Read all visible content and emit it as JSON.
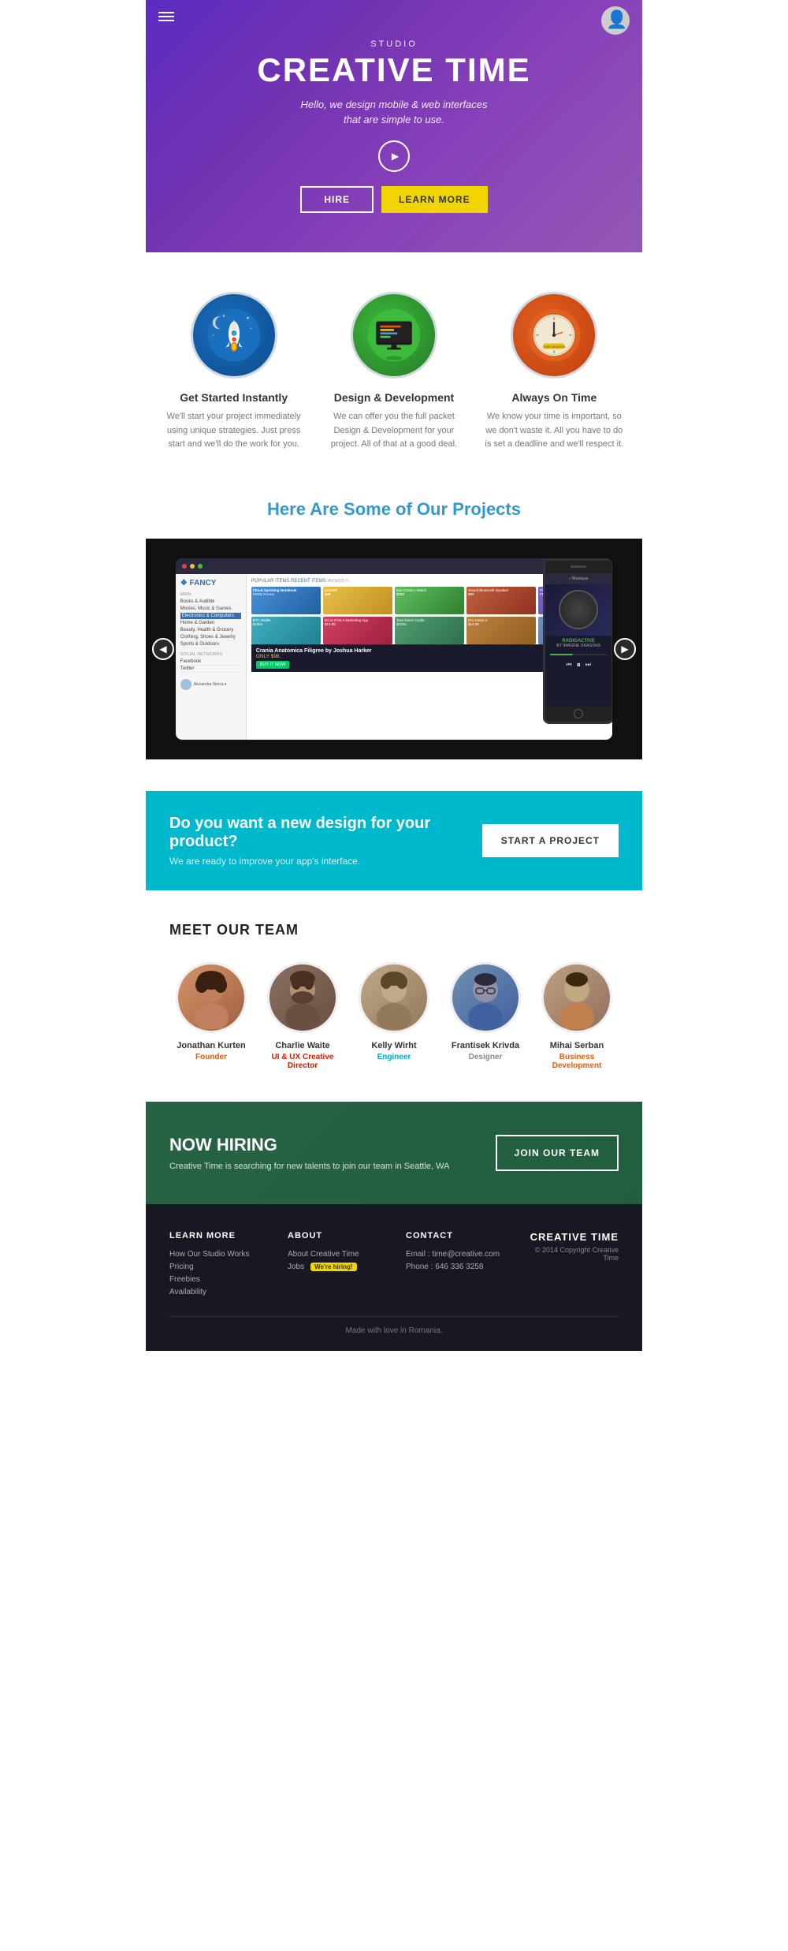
{
  "hero": {
    "studio_label": "STUDIO",
    "title": "CREATIVE TIME",
    "subtitle_line1": "Hello, we design mobile & web interfaces",
    "subtitle_line2": "that are simple to use.",
    "btn_hire": "HIRE",
    "btn_learn": "LEARN MORE"
  },
  "features": [
    {
      "id": "rocket",
      "title": "Get Started Instantly",
      "desc": "We'll start your project immediately using unique strategies. Just press start and we'll do the work for you."
    },
    {
      "id": "design",
      "title": "Design & Development",
      "desc": "We can offer you the full packet Design & Development for your project. All of that at a good deal."
    },
    {
      "id": "time",
      "title": "Always On Time",
      "desc": "We know your time is important, so we don't waste it. All you have to do is set a deadline and we'll respect it."
    }
  ],
  "projects": {
    "section_title": "Here Are Some of Our Projects",
    "arrow_left": "◀",
    "arrow_right": "▶",
    "product_name": "Crania Anatomica Filigree by Joshua Harker",
    "product_price": "ONLY $98.",
    "buy_label": "BUY IT NOW"
  },
  "cta": {
    "heading": "Do you want a new design for your product?",
    "subtext": "We are ready to improve your app's interface.",
    "button_label": "START A PROJECT"
  },
  "team": {
    "section_title": "MEET OUR TEAM",
    "members": [
      {
        "name": "Jonathan Kurten",
        "role": "Founder",
        "role_class": "role-orange"
      },
      {
        "name": "Charlie Waite",
        "role": "UI & UX Creative Director",
        "role_class": "role-red"
      },
      {
        "name": "Kelly Wirht",
        "role": "Engineer",
        "role_class": "role-cyan"
      },
      {
        "name": "Frantisek Krivda",
        "role": "Designer",
        "role_class": "role-gray"
      },
      {
        "name": "Mihai Serban",
        "role": "Business Development",
        "role_class": "role-orange2"
      }
    ]
  },
  "hiring": {
    "label": "NOW HIRING",
    "desc": "Creative Time is searching for new talents to join our team in Seattle, WA",
    "button_label": "JOIN OUR TEAM"
  },
  "footer": {
    "brand_name": "CREATIVE TIME",
    "copyright": "© 2014 Copyright Creative Time",
    "made_with": "Made with love in Romania.",
    "cols": [
      {
        "title": "LEARN MORE",
        "links": [
          "How Our Studio Works",
          "Pricing",
          "Freebies",
          "Availability"
        ]
      },
      {
        "title": "ABOUT",
        "links": [
          "About Creative Time",
          "Jobs"
        ]
      },
      {
        "title": "CONTACT",
        "links": [
          "Email : time@creative.com",
          "Phone : 646 336 3258"
        ]
      }
    ],
    "jobs_badge": "We're hiring!"
  }
}
